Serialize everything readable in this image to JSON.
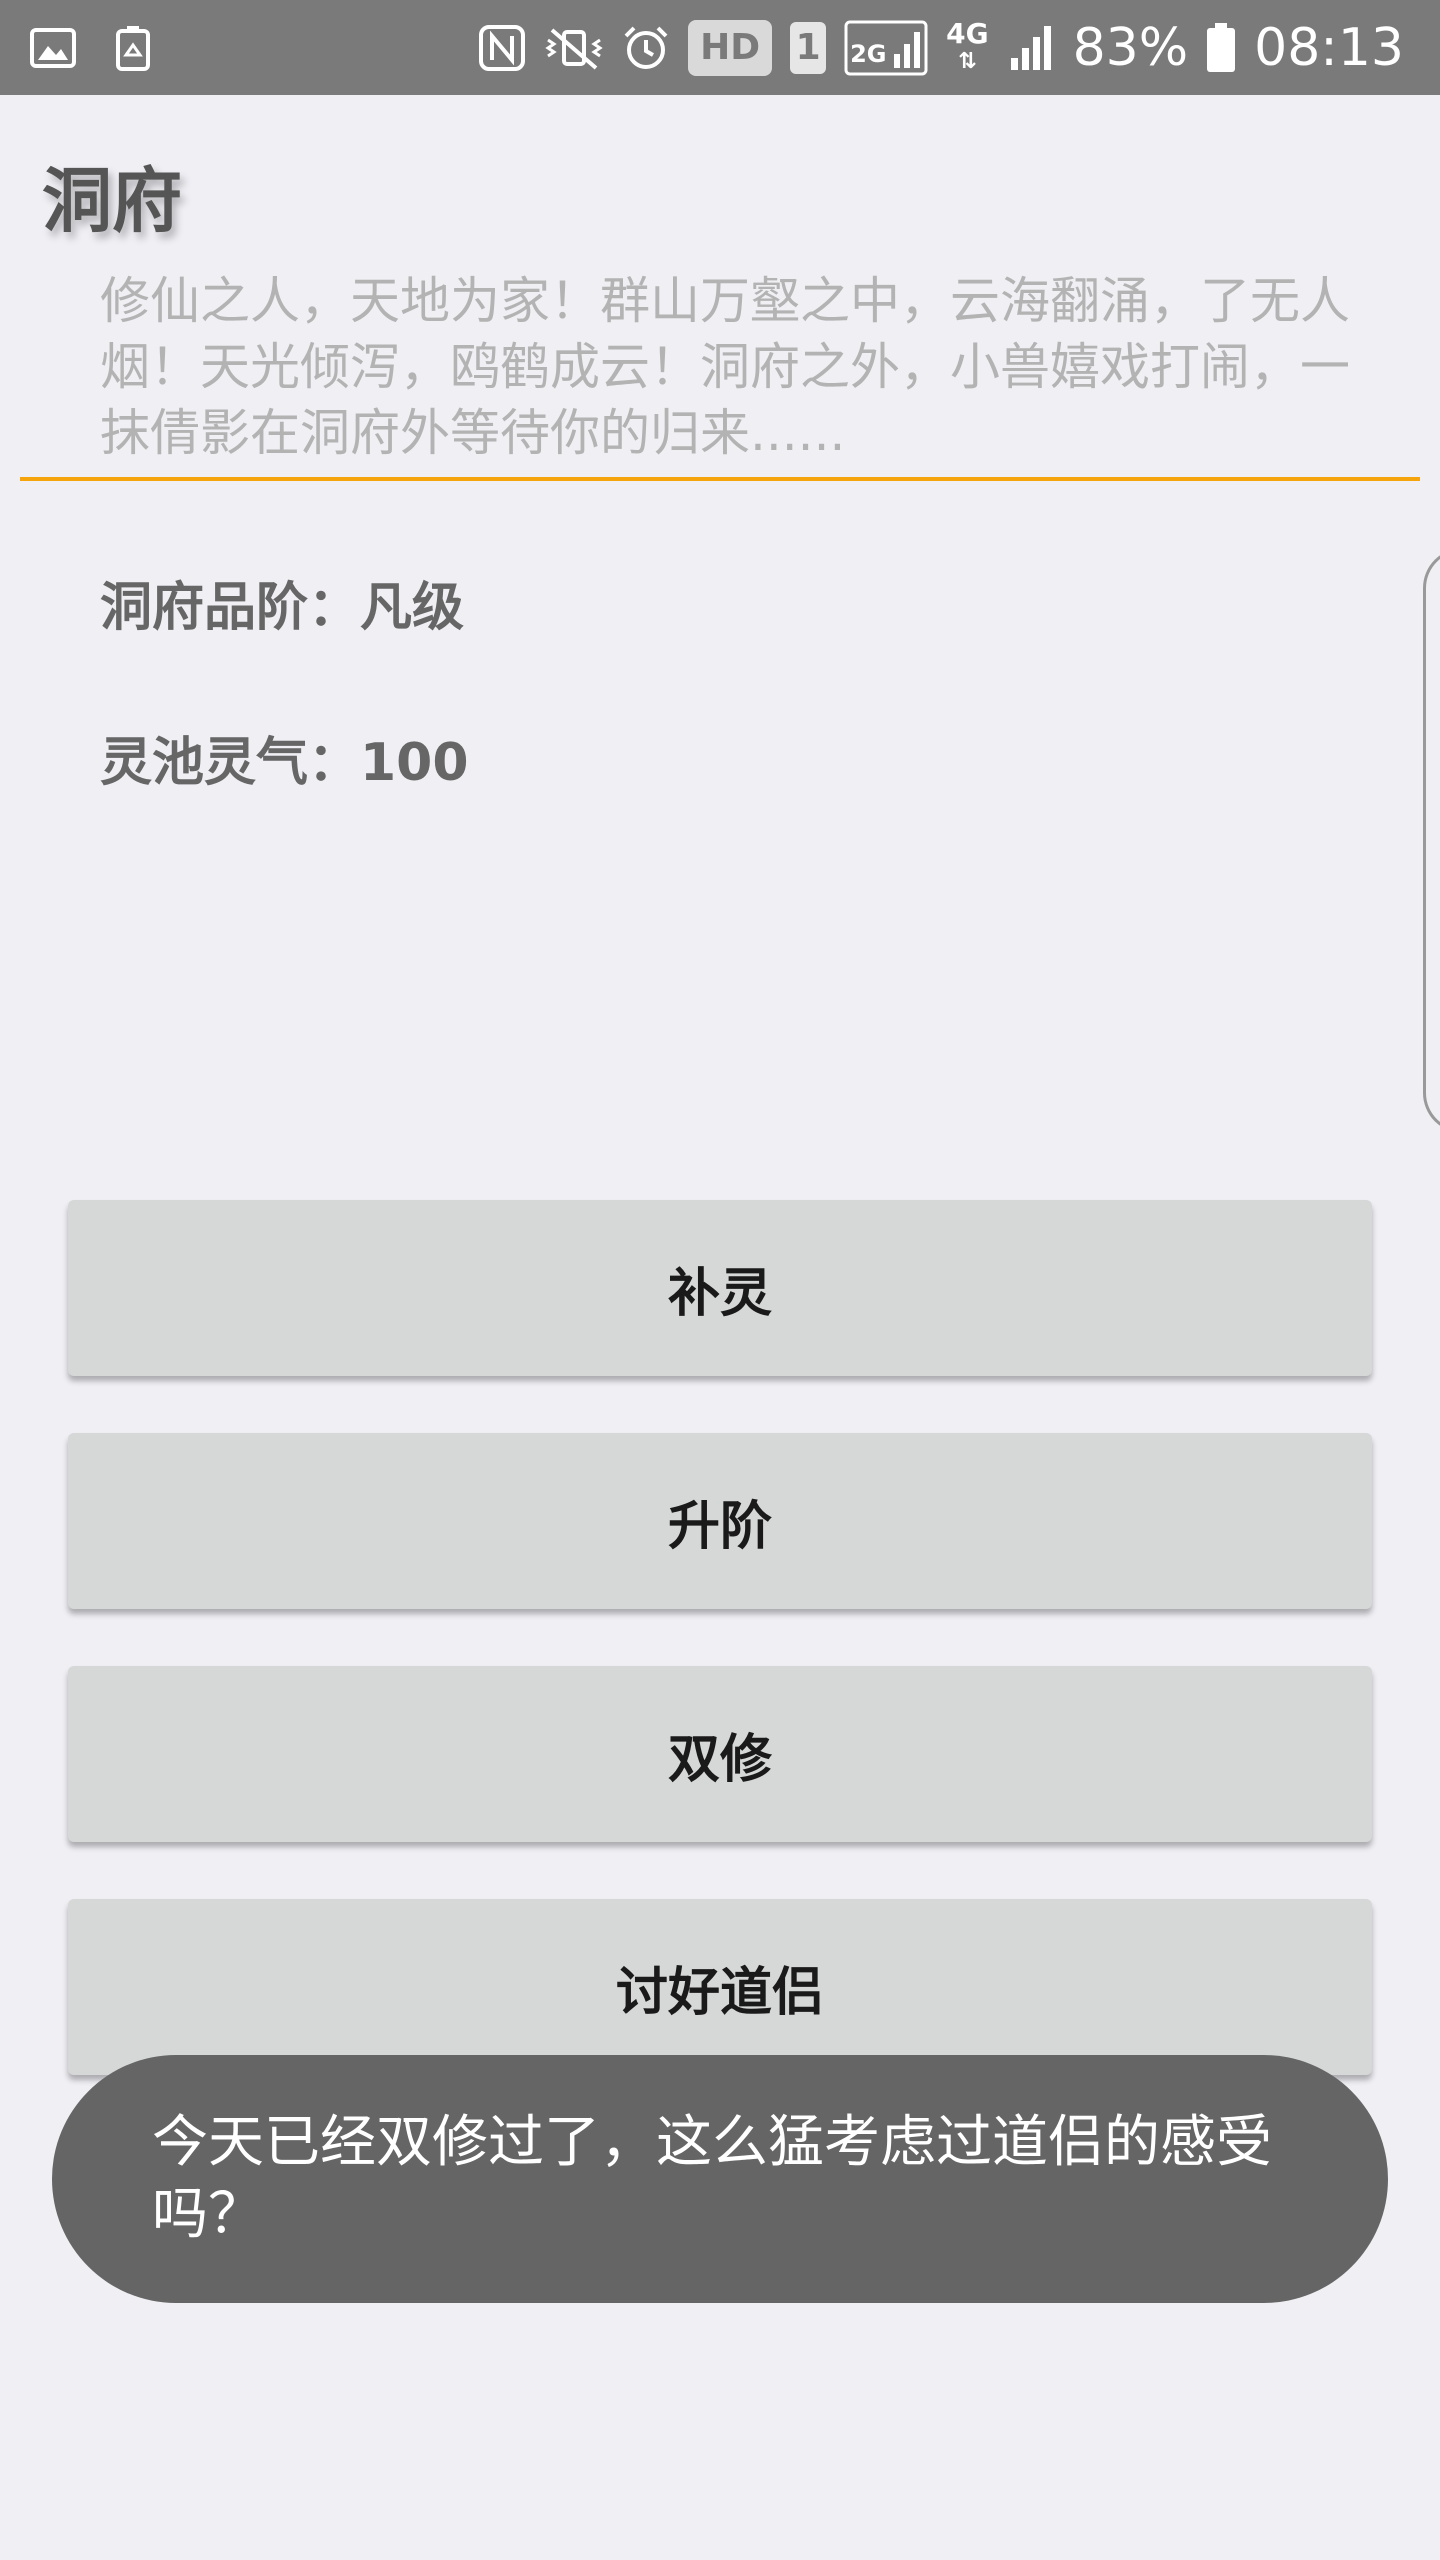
{
  "status_bar": {
    "left_icons": [
      "gallery-icon",
      "recycle-icon"
    ],
    "right_icons": [
      "nfc-icon",
      "vibrate-mute-icon",
      "alarm-icon",
      "hd-badge",
      "sim-badge",
      "signal-2g-icon",
      "network-4g-icon",
      "signal-icon",
      "battery-icon"
    ],
    "hd": "HD",
    "sim": "1",
    "network_2g": "2G",
    "network_4g": "4G",
    "battery_percent": "83%",
    "time": "08:13"
  },
  "page": {
    "title": "洞府",
    "description": "修仙之人，天地为家！群山万壑之中，云海翻涌，了无人烟！天光倾泻，鸥鹤成云！洞府之外，小兽嬉戏打闹，一抹倩影在洞府外等待你的归来......",
    "grade_line": "洞府品阶：凡级",
    "energy_line": "灵池灵气：100"
  },
  "colors": {
    "status_bar": "#7a7a7a",
    "background": "#efeff4",
    "accent_divider": "#f5a40b",
    "button": "#d6d7d7",
    "toast": "#656565"
  },
  "actions": {
    "replenish": "补灵",
    "upgrade": "升阶",
    "dual_cultivation": "双修",
    "please_partner": "讨好道侣"
  },
  "toast": {
    "message": "今天已经双修过了，这么猛考虑过道侣的感受吗？"
  }
}
